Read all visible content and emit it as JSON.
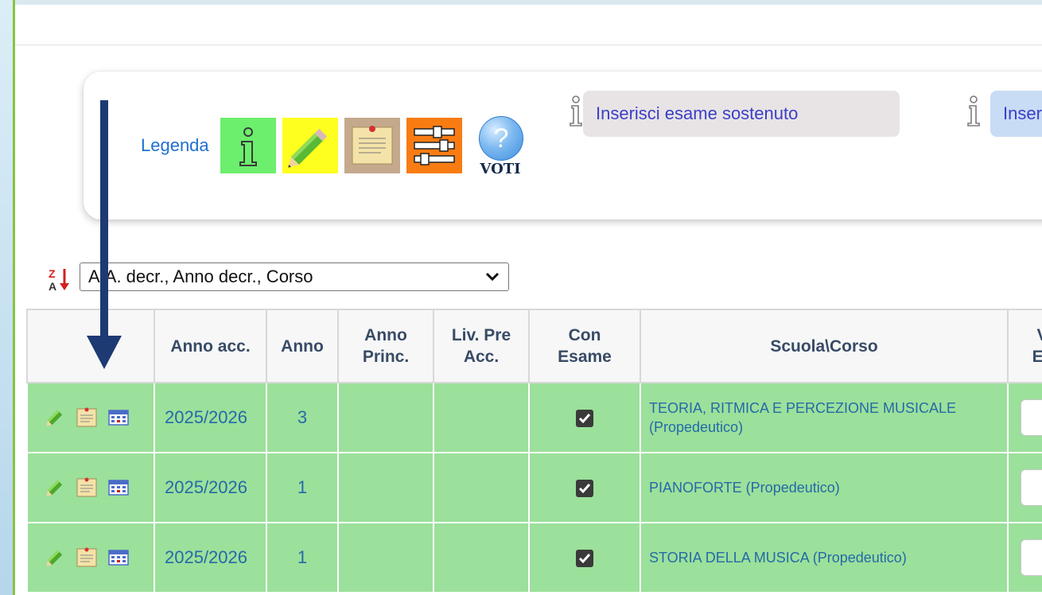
{
  "legend": {
    "label": "Legenda",
    "voti_label": "VOTI",
    "voti_symbol": "?",
    "icons": [
      "info-icon",
      "pencil-icon",
      "note-icon",
      "sliders-icon",
      "help-icon"
    ],
    "hints": [
      {
        "text": "Inserisci esame sostenuto"
      },
      {
        "text": "Inser"
      }
    ]
  },
  "sort": {
    "selected": "A.A. decr., Anno decr., Corso",
    "icon": "sort-za-icon"
  },
  "table": {
    "headers": {
      "actions": "",
      "anno_acc": "Anno acc.",
      "anno": "Anno",
      "anno_princ_1": "Anno",
      "anno_princ_2": "Princ.",
      "liv_pre_1": "Liv. Pre",
      "liv_pre_2": "Acc.",
      "con_esame_1": "Con",
      "con_esame_2": "Esame",
      "scuola_corso": "Scuola\\Corso",
      "voto_1": "V",
      "voto_2": "Es"
    },
    "rows": [
      {
        "anno_acc": "2025/2026",
        "anno": "3",
        "anno_princ": "",
        "liv_pre": "",
        "con_esame": true,
        "corso_1": "TEORIA, RITMICA E PERCEZIONE MUSICALE",
        "corso_2": "(Propedeutico)"
      },
      {
        "anno_acc": "2025/2026",
        "anno": "1",
        "anno_princ": "",
        "liv_pre": "",
        "con_esame": true,
        "corso_1": "PIANOFORTE (Propedeutico)",
        "corso_2": ""
      },
      {
        "anno_acc": "2025/2026",
        "anno": "1",
        "anno_princ": "",
        "liv_pre": "",
        "con_esame": true,
        "corso_1": "STORIA DELLA MUSICA (Propedeutico)",
        "corso_2": ""
      }
    ]
  },
  "colors": {
    "row_bg": "#9be09b",
    "legend_text": "#1f6fd1",
    "arrow": "#1d3a73",
    "accent_green": "#86c43f"
  }
}
